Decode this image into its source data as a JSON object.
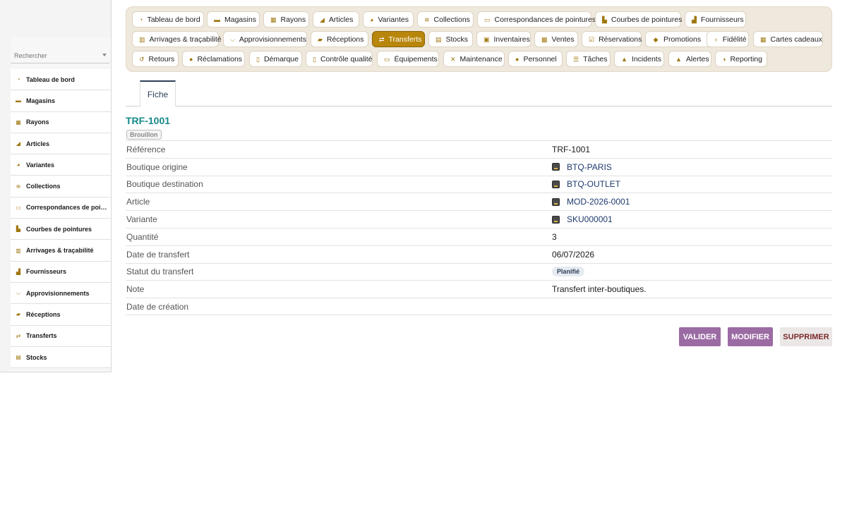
{
  "sidebar": {
    "search_placeholder": "Rechercher",
    "items": [
      {
        "label": "Tableau de bord",
        "icon": "dashboard-icon"
      },
      {
        "label": "Magasins",
        "icon": "store-icon"
      },
      {
        "label": "Rayons",
        "icon": "grid-icon"
      },
      {
        "label": "Articles",
        "icon": "shoe-icon"
      },
      {
        "label": "Variantes",
        "icon": "palette-icon"
      },
      {
        "label": "Collections",
        "icon": "layers-icon"
      },
      {
        "label": "Correspondances de pointures",
        "icon": "ruler-icon"
      },
      {
        "label": "Courbes de pointures",
        "icon": "chart-icon"
      },
      {
        "label": "Arrivages & traçabilité",
        "icon": "barcode-icon"
      },
      {
        "label": "Fournisseurs",
        "icon": "factory-icon"
      },
      {
        "label": "Approvisionnements",
        "icon": "cart-icon"
      },
      {
        "label": "Réceptions",
        "icon": "truck-icon"
      },
      {
        "label": "Transferts",
        "icon": "transfer-icon"
      },
      {
        "label": "Stocks",
        "icon": "box-icon"
      }
    ]
  },
  "topnav": {
    "items": [
      {
        "label": "Tableau de bord",
        "icon": "dashboard-icon"
      },
      {
        "label": "Magasins",
        "icon": "store-icon"
      },
      {
        "label": "Rayons",
        "icon": "grid-icon"
      },
      {
        "label": "Articles",
        "icon": "shoe-icon"
      },
      {
        "label": "Variantes",
        "icon": "palette-icon"
      },
      {
        "label": "Collections",
        "icon": "layers-icon"
      },
      {
        "label": "Correspondances de pointures",
        "icon": "ruler-icon"
      },
      {
        "label": "Courbes de pointures",
        "icon": "chart-icon"
      },
      {
        "label": "Fournisseurs",
        "icon": "factory-icon"
      },
      {
        "label": "Arrivages & traçabilité",
        "icon": "barcode-icon"
      },
      {
        "label": "Approvisionnements",
        "icon": "cart-icon"
      },
      {
        "label": "Réceptions",
        "icon": "truck-icon"
      },
      {
        "label": "Transferts",
        "icon": "transfer-icon",
        "active": true
      },
      {
        "label": "Stocks",
        "icon": "box-icon"
      },
      {
        "label": "Inventaires",
        "icon": "clipboard-icon"
      },
      {
        "label": "Ventes",
        "icon": "register-icon"
      },
      {
        "label": "Réservations",
        "icon": "calendar-check-icon"
      },
      {
        "label": "Promotions",
        "icon": "tag-icon"
      },
      {
        "label": "Fidélité",
        "icon": "medal-icon"
      },
      {
        "label": "Cartes cadeaux",
        "icon": "gift-icon"
      },
      {
        "label": "Retours",
        "icon": "return-icon"
      },
      {
        "label": "Réclamations",
        "icon": "comment-icon"
      },
      {
        "label": "Démarque",
        "icon": "trash-icon"
      },
      {
        "label": "Contrôle qualité",
        "icon": "checklist-icon"
      },
      {
        "label": "Équipements",
        "icon": "monitor-icon"
      },
      {
        "label": "Maintenance",
        "icon": "tools-icon"
      },
      {
        "label": "Personnel",
        "icon": "users-icon"
      },
      {
        "label": "Tâches",
        "icon": "list-icon"
      },
      {
        "label": "Incidents",
        "icon": "warning-icon"
      },
      {
        "label": "Alertes",
        "icon": "bell-icon"
      },
      {
        "label": "Reporting",
        "icon": "pie-icon"
      }
    ],
    "active_color": "#b8860b"
  },
  "tabs": {
    "fiche": "Fiche"
  },
  "record": {
    "title": "TRF-1001",
    "state": "Brouillon",
    "fields": [
      {
        "label": "Référence",
        "value": "TRF-1001"
      },
      {
        "label": "Boutique origine",
        "value": "BTQ-PARIS",
        "link": true
      },
      {
        "label": "Boutique destination",
        "value": "BTQ-OUTLET",
        "link": true
      },
      {
        "label": "Article",
        "value": "MOD-2026-0001",
        "link": true
      },
      {
        "label": "Variante",
        "value": "SKU000001",
        "link": true
      },
      {
        "label": "Quantité",
        "value": "3"
      },
      {
        "label": "Date de transfert",
        "value": "06/07/2026"
      },
      {
        "label": "Statut du transfert",
        "value": "Planifié",
        "pill": true
      },
      {
        "label": "Note",
        "value": "Transfert inter-boutiques."
      },
      {
        "label": "Date de création",
        "value": ""
      }
    ]
  },
  "actions": {
    "valider": "VALIDER",
    "modifier": "MODIFIER",
    "supprimer": "SUPPRIMER"
  }
}
